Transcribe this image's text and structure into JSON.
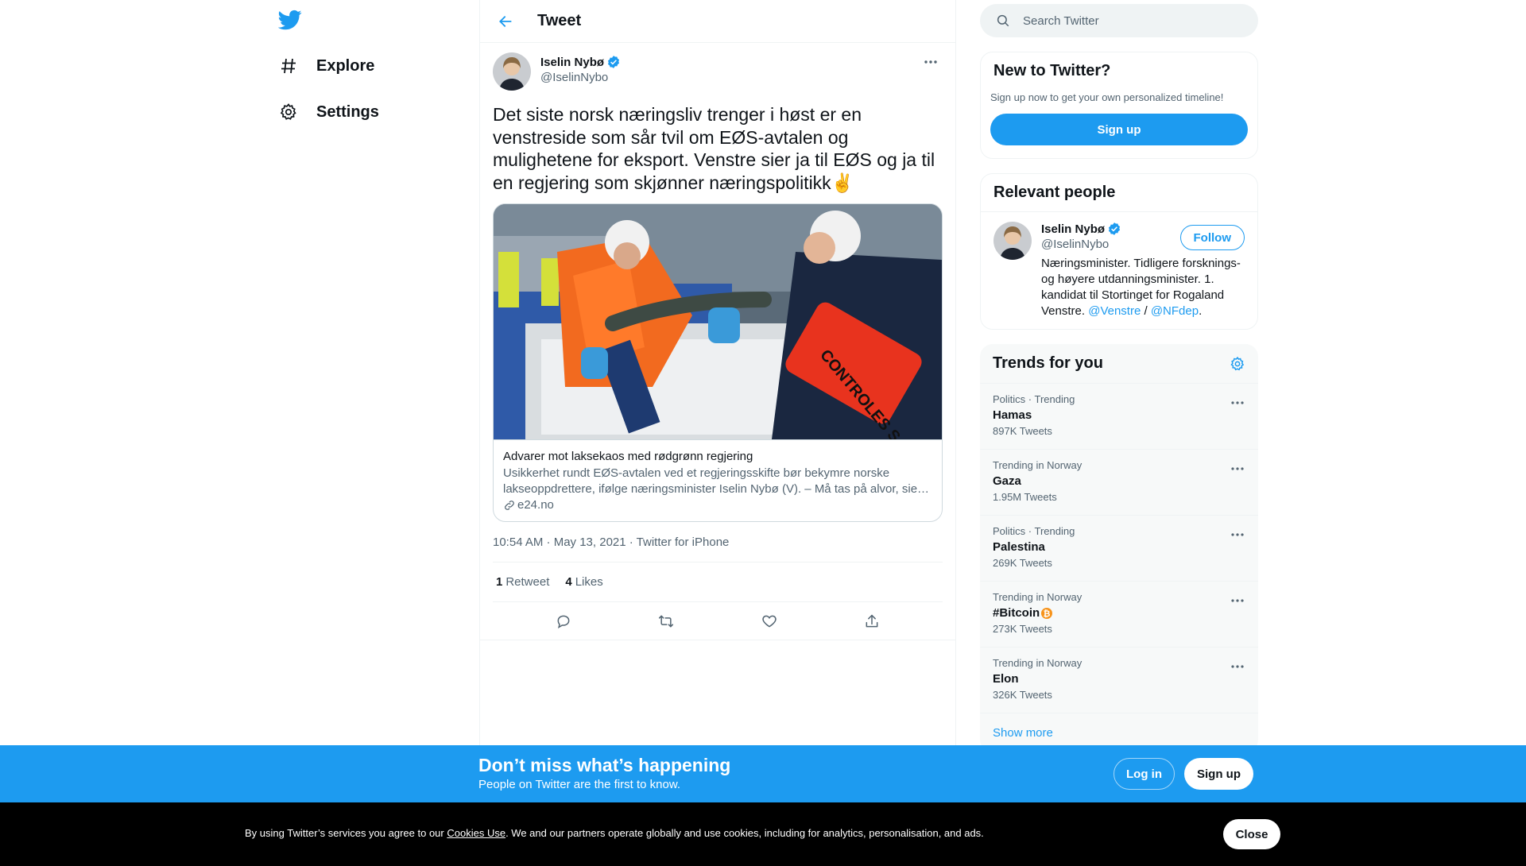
{
  "nav": {
    "items": [
      {
        "label": "Explore",
        "icon": "hashtag-icon"
      },
      {
        "label": "Settings",
        "icon": "gear-icon"
      }
    ]
  },
  "header": {
    "title": "Tweet"
  },
  "tweet": {
    "author_name": "Iselin Nybø",
    "author_handle": "@IselinNybo",
    "text": "Det siste norsk næringsliv trenger i høst er en venstreside som sår tvil om EØS-avtalen og mulighetene for eksport. Venstre sier ja til EØS og ja til en regjering som skjønner næringspolitikk✌️",
    "card": {
      "title": "Advarer mot laksekaos med rødgrønn regjering",
      "description": "Usikkerhet rundt EØS-avtalen ved et regjeringsskifte bør bekymre norske lakseoppdrettere, ifølge næringsminister Iselin Nybø (V). – Må tas på alvor, sie…",
      "domain": "e24.no",
      "image_armband_text": "CONTROLES SANITAIRES"
    },
    "timestamp": "10:54 AM · May 13, 2021 · Twitter for iPhone",
    "retweets_count": "1",
    "retweets_label": "Retweet",
    "likes_count": "4",
    "likes_label": "Likes"
  },
  "search": {
    "placeholder": "Search Twitter"
  },
  "new_to_twitter": {
    "title": "New to Twitter?",
    "subtitle": "Sign up now to get your own personalized timeline!",
    "button": "Sign up"
  },
  "relevant_people": {
    "title": "Relevant people",
    "person": {
      "name": "Iselin Nybø",
      "handle": "@IselinNybo",
      "follow_label": "Follow",
      "bio_text": "Næringsminister. Tidligere forsknings- og høyere utdanningsminister. 1. kandidat til Stortinget for Rogaland Venstre.",
      "bio_link1": "@Venstre",
      "bio_sep": "/",
      "bio_link2": "@NFdep",
      "bio_end": "."
    }
  },
  "trends": {
    "title": "Trends for you",
    "items": [
      {
        "context": "Politics · Trending",
        "name": "Hamas",
        "count": "897K Tweets"
      },
      {
        "context": "Trending in Norway",
        "name": "Gaza",
        "count": "1.95M Tweets"
      },
      {
        "context": "Politics · Trending",
        "name": "Palestina",
        "count": "269K Tweets"
      },
      {
        "context": "Trending in Norway",
        "name": "#Bitcoin",
        "count": "273K Tweets"
      },
      {
        "context": "Trending in Norway",
        "name": "Elon",
        "count": "326K Tweets"
      }
    ],
    "show_more": "Show more"
  },
  "bottom_bar": {
    "title": "Don’t miss what’s happening",
    "subtitle": "People on Twitter are the first to know.",
    "login": "Log in",
    "signup": "Sign up"
  },
  "cookie": {
    "prefix": "By using Twitter’s services you agree to our ",
    "link": "Cookies Use",
    "suffix": ". We and our partners operate globally and use cookies, including for analytics, personalisation, and ads.",
    "close": "Close"
  },
  "colors": {
    "accent": "#1d9bf0",
    "text": "#0f1419",
    "muted": "#536471",
    "bitcoin": "#f7931a"
  }
}
